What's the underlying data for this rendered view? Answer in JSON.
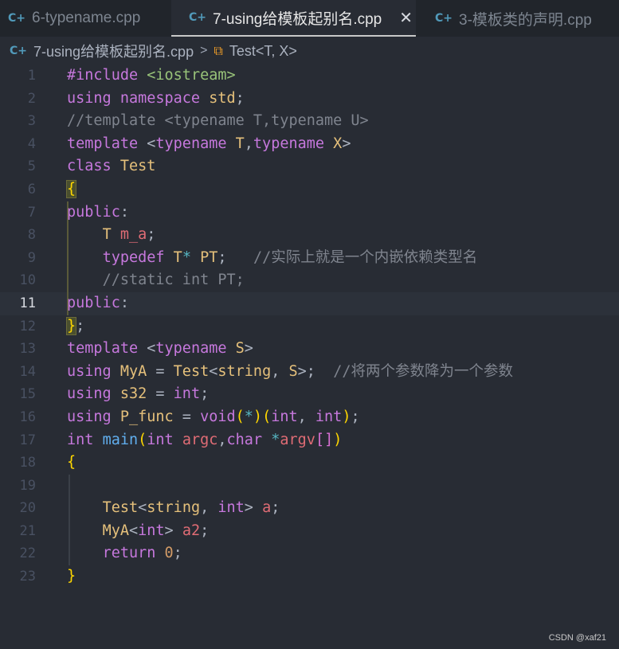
{
  "tabs": [
    {
      "icon": "cpp-file-icon",
      "glyph": "C+",
      "label": "6-typename.cpp"
    },
    {
      "icon": "cpp-file-icon",
      "glyph": "C+",
      "label": "7-using给模板起别名.cpp",
      "close": "✕"
    },
    {
      "icon": "cpp-file-icon",
      "glyph": "C+",
      "label": "3-模板类的声明.cpp"
    }
  ],
  "breadcrumb": {
    "file": "7-using给模板起别名.cpp",
    "separator": ">",
    "symbol": "Test<T, X>",
    "symbol_icon": "struct-icon",
    "symbol_glyph": "⧉"
  },
  "editor": {
    "current_line": 11,
    "lines": [
      {
        "n": "1",
        "tokens": [
          [
            "kw",
            "#include "
          ],
          [
            "st",
            "<iostream>"
          ]
        ]
      },
      {
        "n": "2",
        "tokens": [
          [
            "kw",
            "using "
          ],
          [
            "kw",
            "namespace "
          ],
          [
            "ty",
            "std"
          ],
          [
            "pn",
            ";"
          ]
        ]
      },
      {
        "n": "3",
        "tokens": [
          [
            "cm",
            "//template <typename T,typename U>"
          ]
        ]
      },
      {
        "n": "4",
        "tokens": [
          [
            "kw",
            "template "
          ],
          [
            "pn",
            "<"
          ],
          [
            "kw",
            "typename "
          ],
          [
            "ty",
            "T"
          ],
          [
            "pn",
            ","
          ],
          [
            "kw",
            "typename "
          ],
          [
            "ty",
            "X"
          ],
          [
            "pn",
            ">"
          ]
        ]
      },
      {
        "n": "5",
        "tokens": [
          [
            "kw",
            "class "
          ],
          [
            "ty",
            "Test"
          ]
        ]
      },
      {
        "n": "6",
        "tokens": [
          [
            "b1 hlb",
            "{"
          ]
        ]
      },
      {
        "n": "7",
        "tokens": [
          [
            "kw",
            "public"
          ],
          [
            "pn",
            ":"
          ]
        ]
      },
      {
        "n": "8",
        "tokens": [
          [
            "pn",
            "    "
          ],
          [
            "ty",
            "T "
          ],
          [
            "tp",
            "m_a"
          ],
          [
            "pn",
            ";"
          ]
        ]
      },
      {
        "n": "9",
        "tokens": [
          [
            "pn",
            "    "
          ],
          [
            "kw",
            "typedef "
          ],
          [
            "ty",
            "T"
          ],
          [
            "op",
            "* "
          ],
          [
            "ty",
            "PT"
          ],
          [
            "pn",
            ";   "
          ],
          [
            "cm",
            "//实际上就是一个内嵌依赖类型名"
          ]
        ]
      },
      {
        "n": "10",
        "tokens": [
          [
            "pn",
            "    "
          ],
          [
            "cm",
            "//static int PT;"
          ]
        ]
      },
      {
        "n": "11",
        "tokens": [
          [
            "kw",
            "public"
          ],
          [
            "pn",
            ":"
          ]
        ]
      },
      {
        "n": "12",
        "tokens": [
          [
            "b1 hlb",
            "}"
          ],
          [
            "pn",
            ";"
          ]
        ]
      },
      {
        "n": "13",
        "tokens": [
          [
            "kw",
            "template "
          ],
          [
            "pn",
            "<"
          ],
          [
            "kw",
            "typename "
          ],
          [
            "ty",
            "S"
          ],
          [
            "pn",
            ">"
          ]
        ]
      },
      {
        "n": "14",
        "tokens": [
          [
            "kw",
            "using "
          ],
          [
            "ty",
            "MyA "
          ],
          [
            "pn",
            "= "
          ],
          [
            "ty",
            "Test"
          ],
          [
            "pn",
            "<"
          ],
          [
            "ty",
            "string"
          ],
          [
            "pn",
            ", "
          ],
          [
            "ty",
            "S"
          ],
          [
            "pn",
            ">;  "
          ],
          [
            "cm",
            "//将两个参数降为一个参数"
          ]
        ]
      },
      {
        "n": "15",
        "tokens": [
          [
            "kw",
            "using "
          ],
          [
            "ty",
            "s32 "
          ],
          [
            "pn",
            "= "
          ],
          [
            "kw",
            "int"
          ],
          [
            "pn",
            ";"
          ]
        ]
      },
      {
        "n": "16",
        "tokens": [
          [
            "kw",
            "using "
          ],
          [
            "ty",
            "P_func "
          ],
          [
            "pn",
            "= "
          ],
          [
            "kw",
            "void"
          ],
          [
            "b1",
            "("
          ],
          [
            "op",
            "*"
          ],
          [
            "b1",
            ")"
          ],
          [
            "b1",
            "("
          ],
          [
            "kw",
            "int"
          ],
          [
            "pn",
            ", "
          ],
          [
            "kw",
            "int"
          ],
          [
            "b1",
            ")"
          ],
          [
            "pn",
            ";"
          ]
        ]
      },
      {
        "n": "17",
        "tokens": [
          [
            "kw",
            "int "
          ],
          [
            "fn",
            "main"
          ],
          [
            "b1",
            "("
          ],
          [
            "kw",
            "int "
          ],
          [
            "tp",
            "argc"
          ],
          [
            "pn",
            ","
          ],
          [
            "kw",
            "char "
          ],
          [
            "op",
            "*"
          ],
          [
            "tp",
            "argv"
          ],
          [
            "b2",
            "[]"
          ],
          [
            "b1",
            ")"
          ]
        ]
      },
      {
        "n": "18",
        "tokens": [
          [
            "b1",
            "{"
          ]
        ]
      },
      {
        "n": "19",
        "tokens": []
      },
      {
        "n": "20",
        "tokens": [
          [
            "pn",
            "    "
          ],
          [
            "ty",
            "Test"
          ],
          [
            "pn",
            "<"
          ],
          [
            "ty",
            "string"
          ],
          [
            "pn",
            ", "
          ],
          [
            "kw",
            "int"
          ],
          [
            "pn",
            "> "
          ],
          [
            "tp",
            "a"
          ],
          [
            "pn",
            ";"
          ]
        ]
      },
      {
        "n": "21",
        "tokens": [
          [
            "pn",
            "    "
          ],
          [
            "ty",
            "MyA"
          ],
          [
            "pn",
            "<"
          ],
          [
            "kw",
            "int"
          ],
          [
            "pn",
            "> "
          ],
          [
            "tp",
            "a2"
          ],
          [
            "pn",
            ";"
          ]
        ]
      },
      {
        "n": "22",
        "tokens": [
          [
            "pn",
            "    "
          ],
          [
            "kw",
            "return "
          ],
          [
            "nm",
            "0"
          ],
          [
            "pn",
            ";"
          ]
        ]
      },
      {
        "n": "23",
        "tokens": [
          [
            "b1",
            "}"
          ]
        ]
      }
    ]
  },
  "watermark": "CSDN @xaf21"
}
